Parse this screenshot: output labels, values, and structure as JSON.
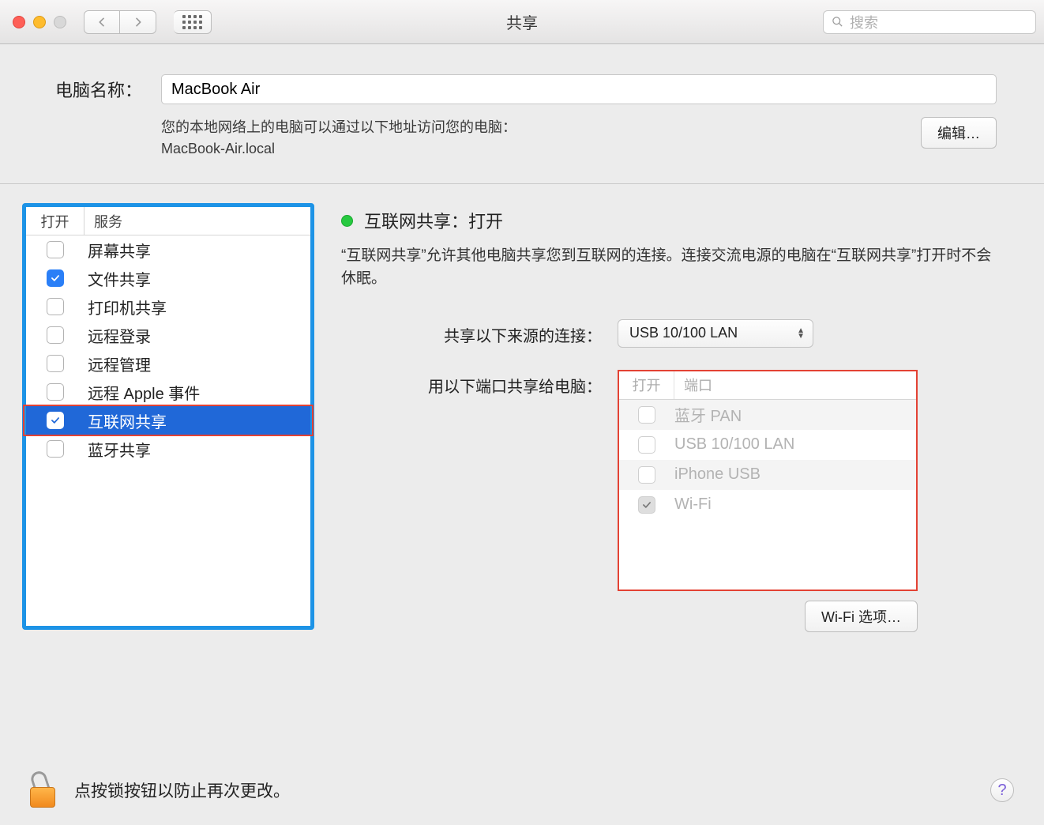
{
  "window": {
    "title": "共享"
  },
  "search": {
    "placeholder": "搜索"
  },
  "computer": {
    "label": "电脑名称：",
    "value": "MacBook Air",
    "desc_line1": "您的本地网络上的电脑可以通过以下地址访问您的电脑：",
    "desc_line2": "MacBook-Air.local",
    "edit_btn": "编辑…"
  },
  "services": {
    "col_on": "打开",
    "col_name": "服务",
    "items": [
      {
        "label": "屏幕共享",
        "checked": false,
        "selected": false
      },
      {
        "label": "文件共享",
        "checked": true,
        "selected": false
      },
      {
        "label": "打印机共享",
        "checked": false,
        "selected": false
      },
      {
        "label": "远程登录",
        "checked": false,
        "selected": false
      },
      {
        "label": "远程管理",
        "checked": false,
        "selected": false
      },
      {
        "label": "远程 Apple 事件",
        "checked": false,
        "selected": false
      },
      {
        "label": "互联网共享",
        "checked": true,
        "selected": true
      },
      {
        "label": "蓝牙共享",
        "checked": false,
        "selected": false
      }
    ]
  },
  "detail": {
    "status_title": "互联网共享：打开",
    "description": "“互联网共享”允许其他电脑共享您到互联网的连接。连接交流电源的电脑在“互联网共享”打开时不会休眠。",
    "source_label": "共享以下来源的连接：",
    "source_value": "USB 10/100 LAN",
    "ports_label": "用以下端口共享给电脑：",
    "ports": {
      "col_on": "打开",
      "col_name": "端口",
      "items": [
        {
          "label": "蓝牙 PAN",
          "checked": false
        },
        {
          "label": "USB 10/100 LAN",
          "checked": false
        },
        {
          "label": "iPhone USB",
          "checked": false
        },
        {
          "label": "Wi-Fi",
          "checked": true
        }
      ]
    },
    "wifi_options_btn": "Wi-Fi 选项…"
  },
  "lock": {
    "text": "点按锁按钮以防止再次更改。"
  }
}
